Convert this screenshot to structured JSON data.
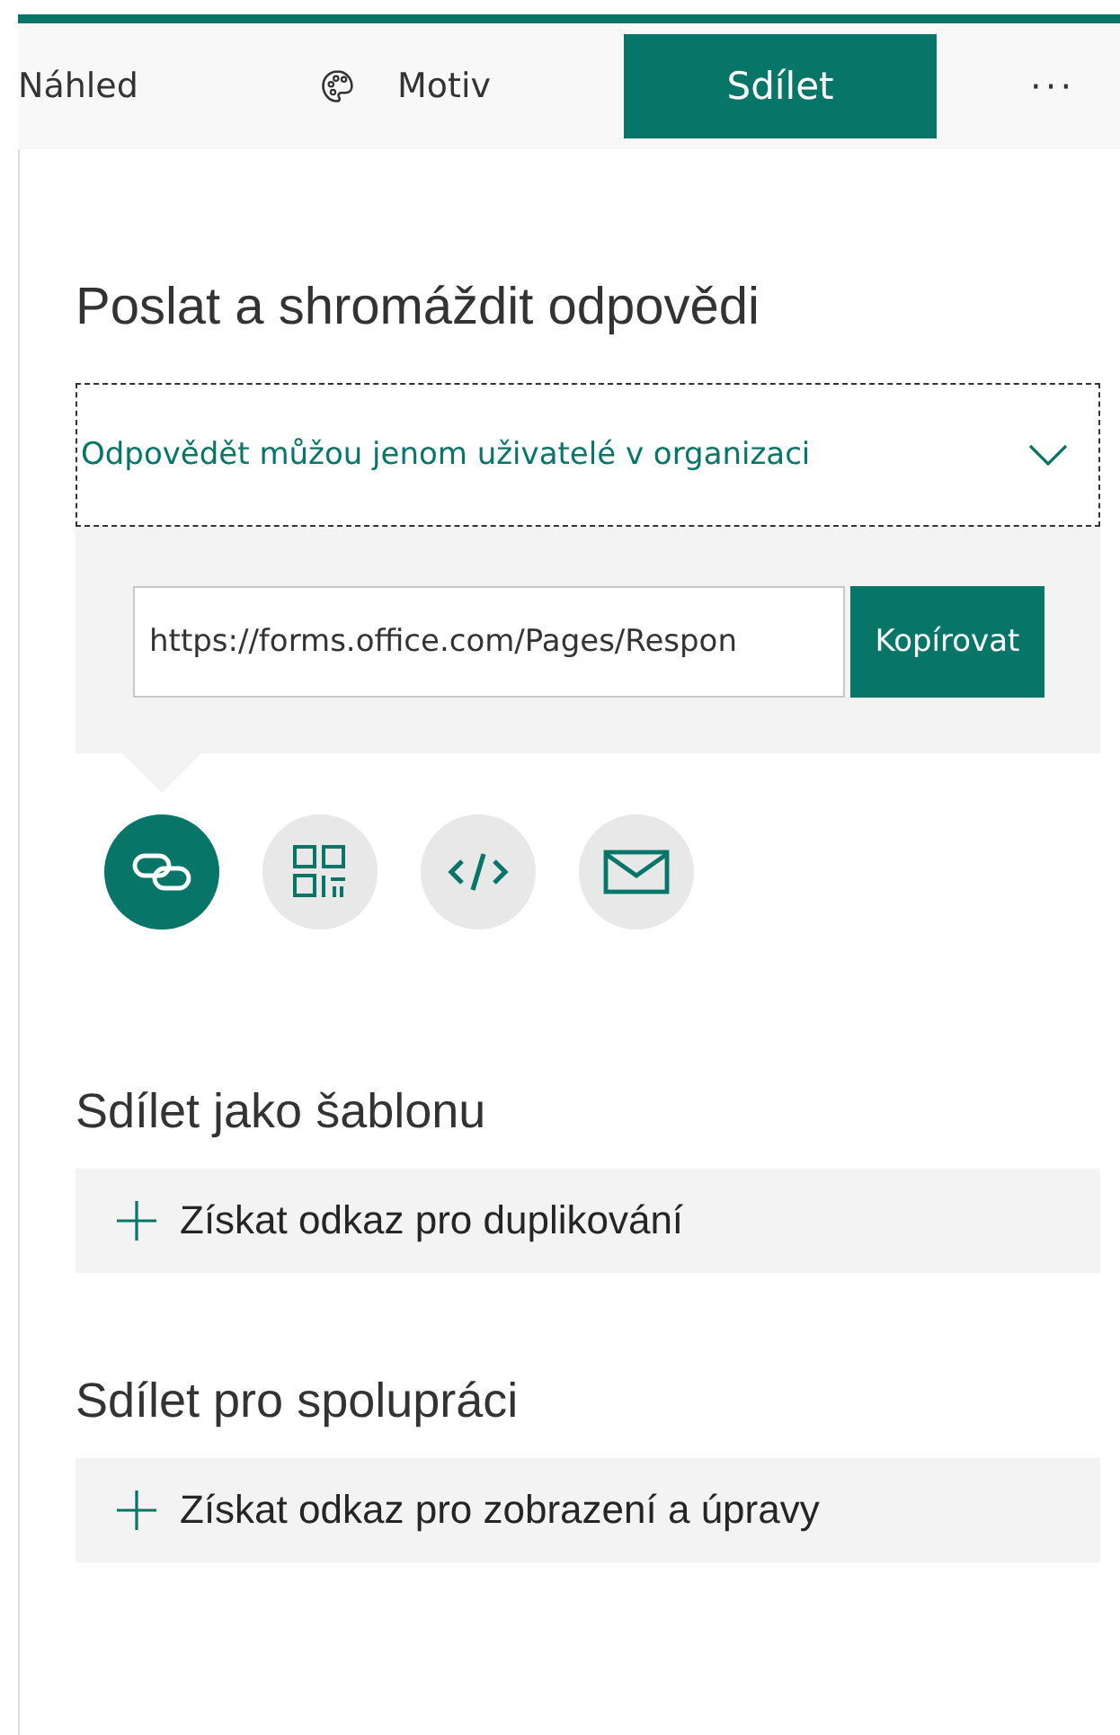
{
  "toolbar": {
    "tabs": [
      {
        "label": "Náhled",
        "kind": "preview",
        "selected": false
      },
      {
        "label": "Motiv",
        "kind": "theme",
        "selected": false
      },
      {
        "label": "Sdílet",
        "kind": "share",
        "selected": true
      }
    ],
    "more": "···"
  },
  "send": {
    "heading": "Poslat a shromáždit odpovědi",
    "audience": "Odpovědět můžou jenom uživatelé v organizaci",
    "link": "https://forms.office.com/Pages/Respon",
    "copy_button": "Kopírovat",
    "share_options": [
      {
        "kind": "link",
        "selected": true
      },
      {
        "kind": "qr",
        "selected": false
      },
      {
        "kind": "embed",
        "selected": false
      },
      {
        "kind": "email",
        "selected": false
      }
    ]
  },
  "sections": [
    {
      "heading": "Sdílet jako šablonu",
      "action": "Získat odkaz pro duplikování"
    },
    {
      "heading": "Sdílet pro spolupráci",
      "action": "Získat odkaz pro zobrazení a úpravy"
    }
  ]
}
